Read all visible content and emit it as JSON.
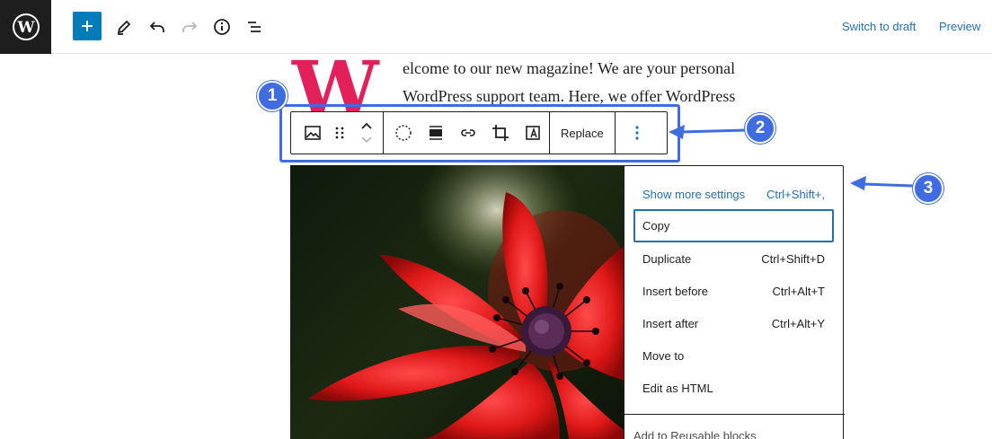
{
  "topbar": {
    "switch_to_draft": "Switch to draft",
    "preview": "Preview"
  },
  "paragraph": {
    "drop_cap": "W",
    "line1": "elcome to our new magazine! We are your personal",
    "line2": "WordPress support team. Here, we offer WordPress"
  },
  "block_toolbar": {
    "replace_label": "Replace"
  },
  "menu": {
    "items": [
      {
        "label": "Show more settings",
        "shortcut": "Ctrl+Shift+,"
      },
      {
        "label": "Copy",
        "shortcut": ""
      },
      {
        "label": "Duplicate",
        "shortcut": "Ctrl+Shift+D"
      },
      {
        "label": "Insert before",
        "shortcut": "Ctrl+Alt+T"
      },
      {
        "label": "Insert after",
        "shortcut": "Ctrl+Alt+Y"
      },
      {
        "label": "Move to",
        "shortcut": ""
      },
      {
        "label": "Edit as HTML",
        "shortcut": ""
      }
    ],
    "partial_item": "Add to Reusable blocks"
  },
  "callouts": [
    "1",
    "2",
    "3"
  ],
  "colors": {
    "accent": "#007cba",
    "annotation": "#3f6ce0",
    "drop_cap": "#e4205b",
    "link": "#2271b1"
  }
}
